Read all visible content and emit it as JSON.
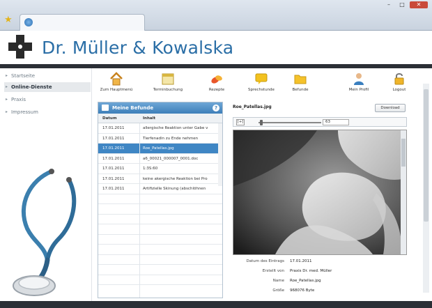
{
  "site": {
    "title_part1": "Dr. Müller ",
    "title_amp": "&",
    "title_part2": " Kowalska"
  },
  "sidebar": {
    "items": [
      {
        "label": "Startseite"
      },
      {
        "label": "Online-Dienste"
      },
      {
        "label": "Praxis"
      },
      {
        "label": "Impressum"
      }
    ]
  },
  "toolbar": {
    "items": [
      {
        "label": "Zum Hauptmenü",
        "icon": "home-icon"
      },
      {
        "label": "Terminbuchung",
        "icon": "calendar-icon"
      },
      {
        "label": "Rezepte",
        "icon": "pills-icon"
      },
      {
        "label": "Sprechstunde",
        "icon": "chat-icon"
      },
      {
        "label": "Befunde",
        "icon": "folder-icon"
      },
      {
        "label": "Mein Profil",
        "icon": "user-icon"
      },
      {
        "label": "Logout",
        "icon": "lock-icon"
      }
    ]
  },
  "befunde": {
    "title": "Meine Befunde",
    "columns": [
      "Datum",
      "Inhalt"
    ],
    "rows": [
      {
        "date": "17.01.2011",
        "content": "allergische Reaktion unter Gabe v"
      },
      {
        "date": "17.01.2011",
        "content": "Tierfenadin zu Ende nehmen"
      },
      {
        "date": "17.01.2011",
        "content": "Roe_Patellas.jpg"
      },
      {
        "date": "17.01.2011",
        "content": "a6_00021_000007_0001.doc"
      },
      {
        "date": "17.01.2011",
        "content": "1:3S:60"
      },
      {
        "date": "17.01.2011",
        "content": "keine akergische Reaktion bei Pro"
      },
      {
        "date": "17.01.2011",
        "content": "Artifizielle Skinung (abschlöhnen"
      }
    ],
    "selected_index": 2
  },
  "viewer": {
    "filename": "Roe_Patellas.jpg",
    "download_label": "Download",
    "zoom_plus": "[+]",
    "zoom_value": "63",
    "meta": [
      {
        "label": "Datum des Eintrags",
        "value": "17.01.2011"
      },
      {
        "label": "Erstellt von",
        "value": "Praxis Dr. med. Müller"
      },
      {
        "label": "Name",
        "value": "Roe_Patellas.jpg"
      },
      {
        "label": "Größe",
        "value": "968076 Byte"
      }
    ]
  },
  "colors": {
    "brand": "#2a6ea6",
    "panel_header": "#3d7fb9",
    "selected_row": "#3f86c4",
    "nav_dark": "#2b2f36"
  }
}
